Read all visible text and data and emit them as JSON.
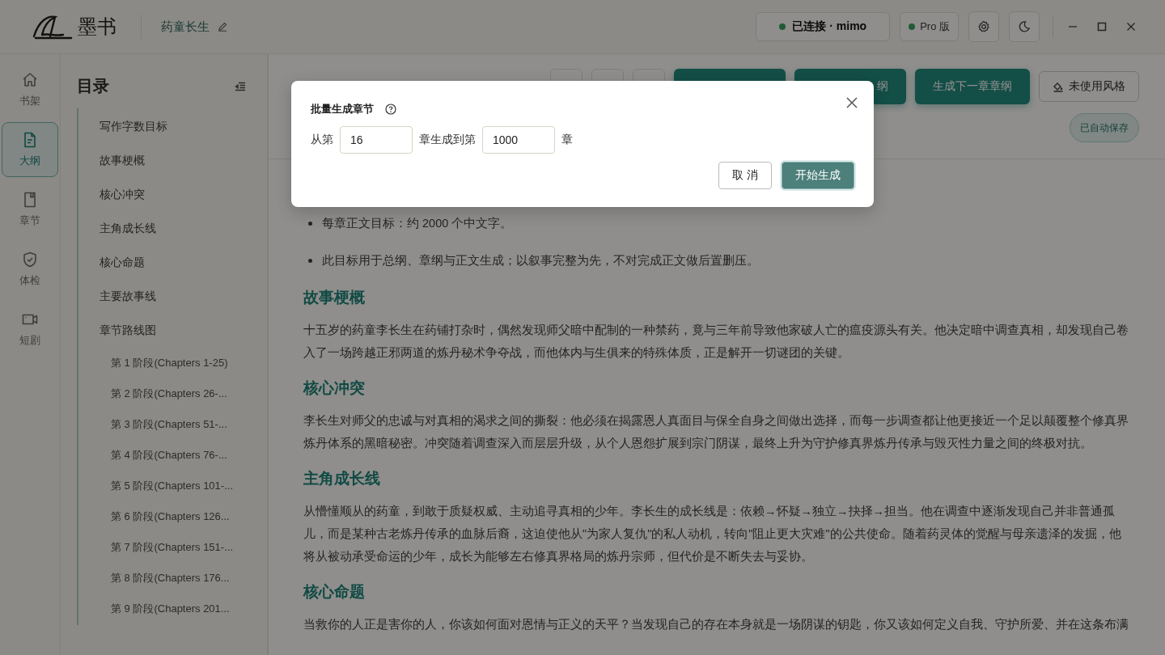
{
  "app": {
    "logo_text": "墨书",
    "project_title": "药童长生"
  },
  "status": {
    "connection": "已连接 · mimo",
    "plan": "Pro 版"
  },
  "nav": [
    {
      "label": "书架",
      "kind": "home",
      "selected": false
    },
    {
      "label": "大纲",
      "kind": "doc",
      "selected": true
    },
    {
      "label": "章节",
      "kind": "book",
      "selected": false
    },
    {
      "label": "体检",
      "kind": "shield",
      "selected": false
    },
    {
      "label": "短剧",
      "kind": "video",
      "selected": false
    }
  ],
  "toc": {
    "title": "目录",
    "items": [
      {
        "label": "写作字数目标"
      },
      {
        "label": "故事梗概"
      },
      {
        "label": "核心冲突"
      },
      {
        "label": "主角成长线"
      },
      {
        "label": "核心命题"
      },
      {
        "label": "主要故事线"
      },
      {
        "label": "章节路线图",
        "children": [
          {
            "label": "第 1 阶段(Chapters 1-25)"
          },
          {
            "label": "第 2 阶段(Chapters 26-..."
          },
          {
            "label": "第 3 阶段(Chapters 51-..."
          },
          {
            "label": "第 4 阶段(Chapters 76-..."
          },
          {
            "label": "第 5 阶段(Chapters 101-..."
          },
          {
            "label": "第 6 阶段(Chapters 126..."
          },
          {
            "label": "第 7 阶段(Chapters 151-..."
          },
          {
            "label": "第 8 阶段(Chapters 176..."
          },
          {
            "label": "第 9 阶段(Chapters 201..."
          }
        ]
      }
    ]
  },
  "main": {
    "actions": [
      {
        "kind": "icon"
      },
      {
        "kind": "icon"
      },
      {
        "kind": "icon"
      },
      {
        "kind": "primary"
      },
      {
        "kind": "primary",
        "label": "纲"
      },
      {
        "kind": "primary",
        "label": "生成下一章章纲"
      },
      {
        "kind": "outline",
        "label": "未使用风格"
      }
    ],
    "save_badge": "已自动保存"
  },
  "content": [
    {
      "kind": "bullet",
      "text": "每章正文目标：约 2000 个中文字。"
    },
    {
      "kind": "bullet",
      "text": "此目标用于总纲、章纲与正文生成；以叙事完整为先，不对完成正文做后置删压。"
    },
    {
      "kind": "heading",
      "text": "故事梗概"
    },
    {
      "kind": "paragraph",
      "text": "十五岁的药童李长生在药铺打杂时，偶然发现师父暗中配制的一种禁药，竟与三年前导致他家破人亡的瘟疫源头有关。他决定暗中调查真相，却发现自己卷入了一场跨越正邪两道的炼丹秘术争夺战，而他体内与生俱来的特殊体质，正是解开一切谜团的关键。"
    },
    {
      "kind": "heading",
      "text": "核心冲突"
    },
    {
      "kind": "paragraph",
      "text": "李长生对师父的忠诚与对真相的渴求之间的撕裂：他必须在揭露恩人真面目与保全自身之间做出选择，而每一步调查都让他更接近一个足以颠覆整个修真界炼丹体系的黑暗秘密。冲突随着调查深入而层层升级，从个人恩怨扩展到宗门阴谋，最终上升为守护修真界炼丹传承与毁灭性力量之间的终极对抗。"
    },
    {
      "kind": "heading",
      "text": "主角成长线"
    },
    {
      "kind": "paragraph",
      "text": "从懵懂顺从的药童，到敢于质疑权威、主动追寻真相的少年。李长生的成长线是：依赖→怀疑→独立→抉择→担当。他在调查中逐渐发现自己并非普通孤儿，而是某种古老炼丹传承的血脉后裔，这迫使他从\"为家人复仇\"的私人动机，转向\"阻止更大灾难\"的公共使命。随着药灵体的觉醒与母亲遗泽的发掘，他将从被动承受命运的少年，成长为能够左右修真界格局的炼丹宗师，但代价是不断失去与妥协。"
    },
    {
      "kind": "heading",
      "text": "核心命题"
    },
    {
      "kind": "paragraph",
      "text": "当救你的人正是害你的人，你该如何面对恩情与正义的天平？当发现自己的存在本身就是一场阴谋的钥匙，你又该如何定义自我、守护所爱、并在这条布满"
    }
  ],
  "dialog": {
    "title": "批量生成章节",
    "row": [
      {
        "kind": "text",
        "text": "从第"
      },
      {
        "kind": "input",
        "value": "16"
      },
      {
        "kind": "text",
        "text": "章生成到第"
      },
      {
        "kind": "input",
        "value": "1000"
      },
      {
        "kind": "text",
        "text": "章"
      }
    ],
    "buttons": [
      {
        "kind": "secondary",
        "label": "取 消"
      },
      {
        "kind": "primary",
        "label": "开始生成"
      }
    ]
  }
}
